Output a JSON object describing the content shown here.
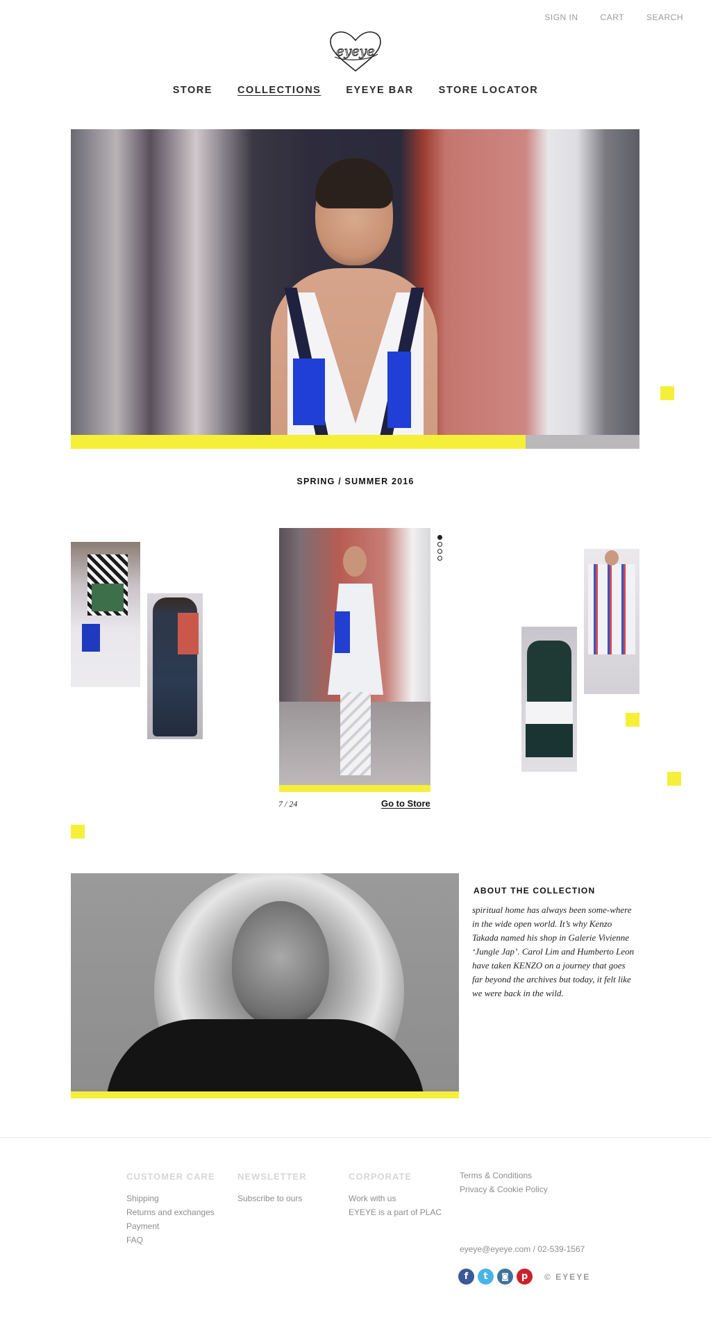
{
  "header": {
    "utility": [
      "SIGN IN",
      "CART",
      "SEARCH"
    ],
    "logo_text": "eyeye",
    "nav": [
      {
        "label": "STORE",
        "active": false
      },
      {
        "label": "COLLECTIONS",
        "active": true
      },
      {
        "label": "EYEYE BAR",
        "active": false
      },
      {
        "label": "STORE LOCATOR",
        "active": false
      }
    ]
  },
  "colors": {
    "accent": "#f6ef3a",
    "text": "#222222",
    "muted": "#8d8d8d"
  },
  "hero": {
    "progress": 0.8
  },
  "season": {
    "title": "SPRING / SUMMER 2016"
  },
  "gallery": {
    "counter": "7 / 24",
    "go_to_store": "Go to Store",
    "dots": [
      true,
      false,
      false,
      false
    ]
  },
  "about": {
    "title": "ABOUT THE COLLECTION",
    "text": "spiritual home has always been some-where in the wide open world.  It’s why Kenzo Takada named his shop in Galerie Vivienne ‘Jungle Jap’.  Carol Lim and Humberto Leon have taken KENZO on a journey that goes far beyond the archives but today, it felt like we were back in the wild."
  },
  "footer": {
    "customer_care": {
      "title": "CUSTOMER CARE",
      "links": [
        "Shipping",
        "Returns and exchanges",
        "Payment",
        "FAQ"
      ]
    },
    "newsletter": {
      "title": "NEWSLETTER",
      "links": [
        "Subscribe to ours"
      ]
    },
    "corporate": {
      "title": "CORPORATE",
      "links": [
        "Work with us",
        "EYEYE is a part of PLAC"
      ]
    },
    "legal": {
      "links": [
        "Terms & Conditions",
        "Privacy & Cookie Policy"
      ]
    },
    "contact": "eyeye@eyeye.com / 02-539-1567",
    "social": [
      {
        "icon": "facebook-icon",
        "glyph": "f",
        "color": "#3b5998"
      },
      {
        "icon": "twitter-icon",
        "glyph": "t",
        "color": "#4ab3e8"
      },
      {
        "icon": "instagram-icon",
        "glyph": "◙",
        "color": "#3f729b"
      },
      {
        "icon": "pinterest-icon",
        "glyph": "p",
        "color": "#cb2027"
      }
    ],
    "copyright": "© EYEYE"
  }
}
